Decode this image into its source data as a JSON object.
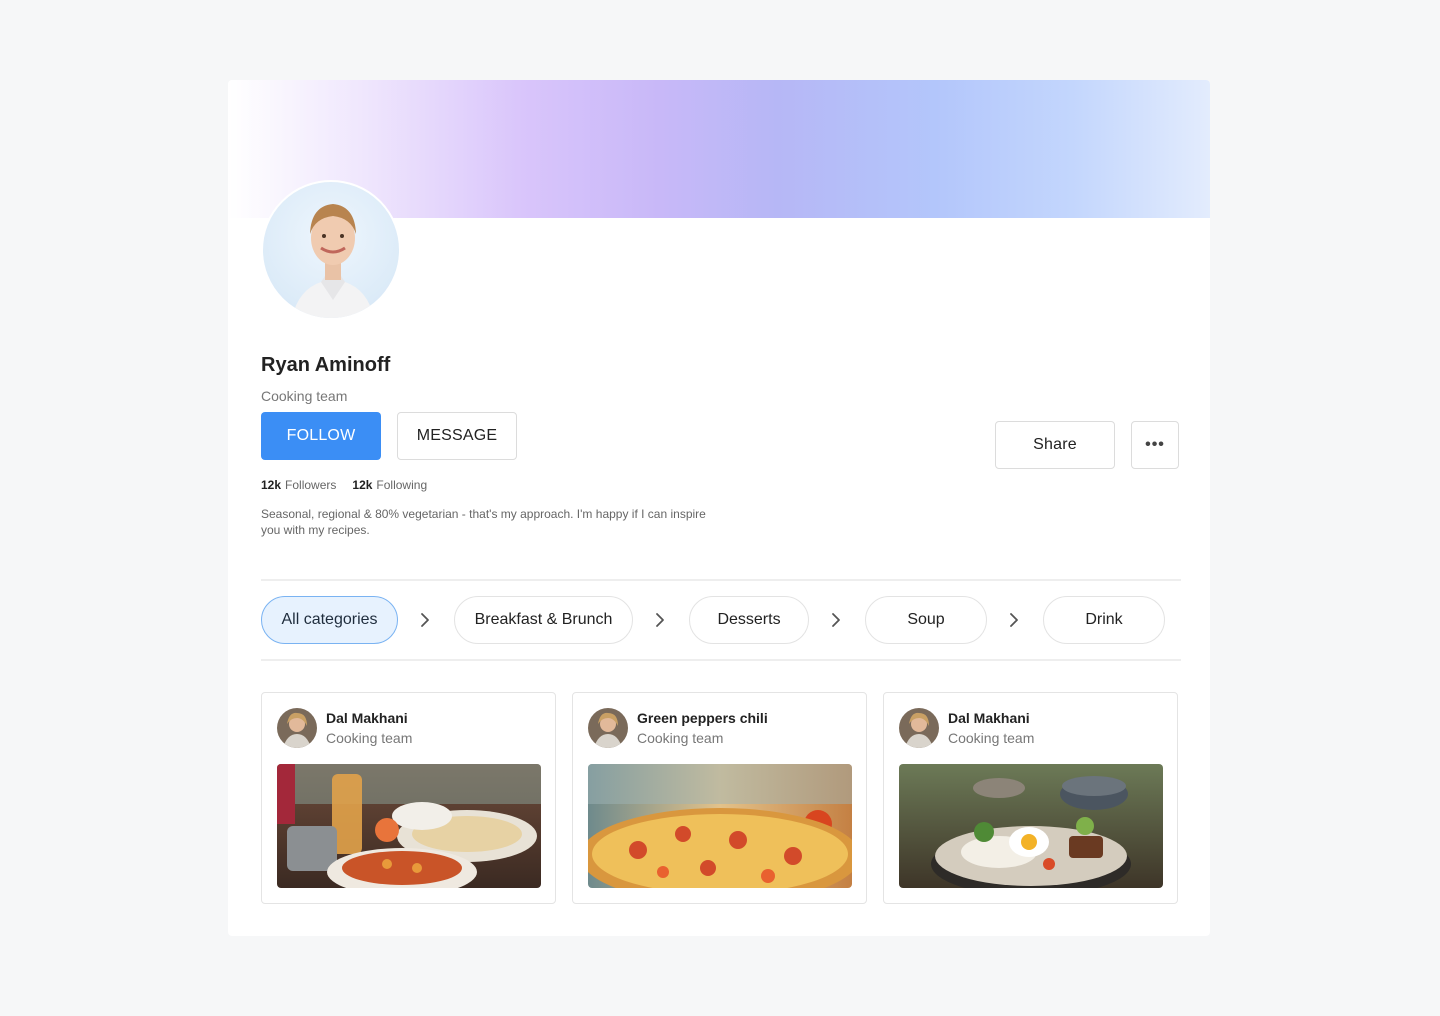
{
  "profile": {
    "name": "Ryan Aminoff",
    "team": "Cooking team",
    "follow_label": "FOLLOW",
    "message_label": "MESSAGE",
    "share_label": "Share",
    "more_label": "•••",
    "followers_count": "12k",
    "followers_label": "Followers",
    "following_count": "12k",
    "following_label": "Following",
    "bio": "Seasonal, regional & 80% vegetarian - that's my approach. I'm happy if I can inspire you with my recipes."
  },
  "categories": [
    {
      "label": "All categories",
      "active": true
    },
    {
      "label": "Breakfast & Brunch",
      "active": false
    },
    {
      "label": "Desserts",
      "active": false
    },
    {
      "label": "Soup",
      "active": false
    },
    {
      "label": "Drink",
      "active": false
    }
  ],
  "posts": [
    {
      "title": "Dal Makhani",
      "subtitle": "Cooking team",
      "image": "indian-dishes-photo"
    },
    {
      "title": "Green peppers chili",
      "subtitle": "Cooking team",
      "image": "pizza-photo"
    },
    {
      "title": "Dal Makhani",
      "subtitle": "Cooking team",
      "image": "egg-bowl-photo"
    }
  ],
  "icons": {
    "chevron": "chevron-right-icon",
    "more": "more-horizontal-icon"
  },
  "colors": {
    "accent": "#3b8ef5",
    "chip_active_bg": "#e7f2fe",
    "chip_active_border": "#7ab3f2"
  }
}
